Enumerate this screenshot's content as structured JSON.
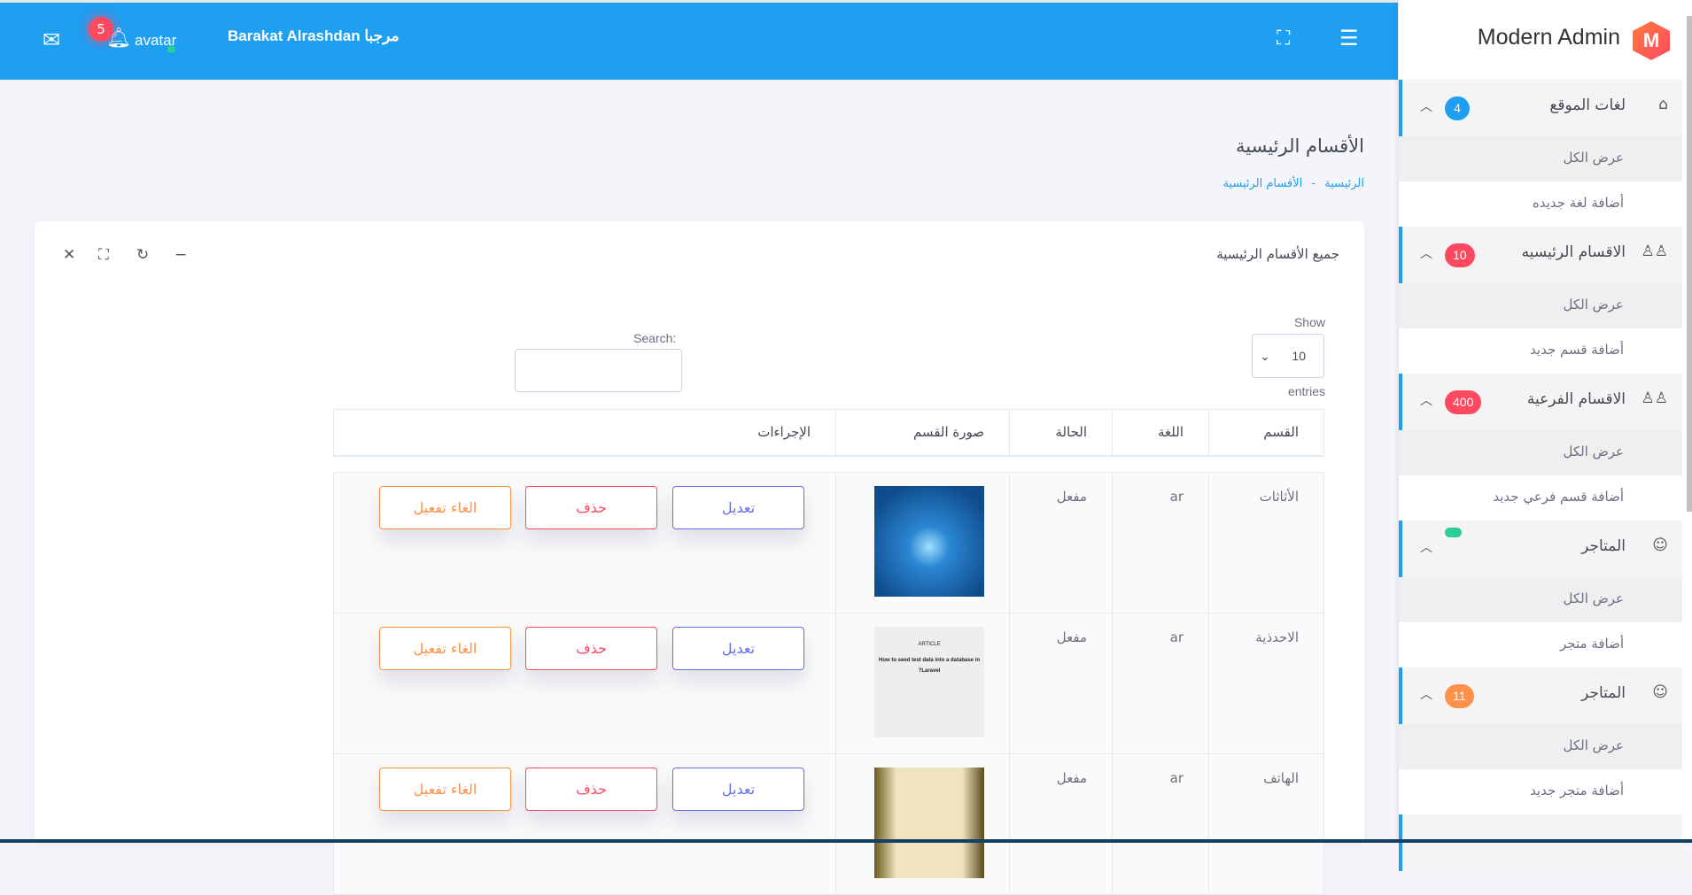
{
  "topbar": {
    "notification_count": "5",
    "avatar_alt": "avatar",
    "greeting": "Barakat Alrashdan مرجبا"
  },
  "sidebar": {
    "brand": "Modern Admin",
    "brand_letter": "M",
    "sections": [
      {
        "label": "لغات الموقع",
        "count": "4",
        "color": "#1e9ff2",
        "icon": "home-icon",
        "sub": [
          "عرض الكل",
          "أضافة لغة جديده"
        ]
      },
      {
        "label": "الاقسام الرئيسيه",
        "count": "10",
        "color": "#ff4961",
        "icon": "users-icon",
        "sub": [
          "عرض الكل",
          "أضافة قسم جديد"
        ]
      },
      {
        "label": "الاقسام الفرعية",
        "count": "400",
        "color": "#ff4961",
        "icon": "users-icon",
        "sub": [
          "عرض الكل",
          "أضافة قسم فرعي جديد"
        ]
      },
      {
        "label": "المتاجر",
        "count": "",
        "color": "#28d094",
        "icon": "face-icon",
        "sub": [
          "عرض الكل",
          "أضافة متجر"
        ]
      },
      {
        "label": "المتاجر",
        "count": "11",
        "color": "#ff9149",
        "icon": "face-icon",
        "sub": [
          "عرض الكل",
          "أضافة متجر جديد"
        ]
      }
    ]
  },
  "page": {
    "title": "الأقسام الرئيسية",
    "breadcrumb": [
      "الرئيسية",
      "الأقسام الرئيسية"
    ],
    "breadcrumb_sep": "-"
  },
  "card": {
    "title": "جميع الأقسام الرئيسية",
    "show_label": "Show",
    "entries_label": "entries",
    "page_size": "10",
    "search_label": "Search:",
    "search_value": ""
  },
  "table": {
    "headers": [
      "القسم",
      "اللغة",
      "الحالة",
      "صورة القسم",
      "الإجراءات"
    ],
    "rows": [
      {
        "name": "الأثاثات",
        "lang": "ar",
        "status": "مفعل"
      },
      {
        "name": "الاحدذية",
        "lang": "ar",
        "status": "مفعل"
      },
      {
        "name": "الهاتف",
        "lang": "ar",
        "status": "مفعل"
      }
    ],
    "actions": {
      "edit": "تعديل",
      "delete": "حذف",
      "deactivate": "الغاء تفعيل"
    },
    "thumb2_text": [
      "ARTICLE",
      "How to seed test data into a database in Laravel?"
    ]
  }
}
